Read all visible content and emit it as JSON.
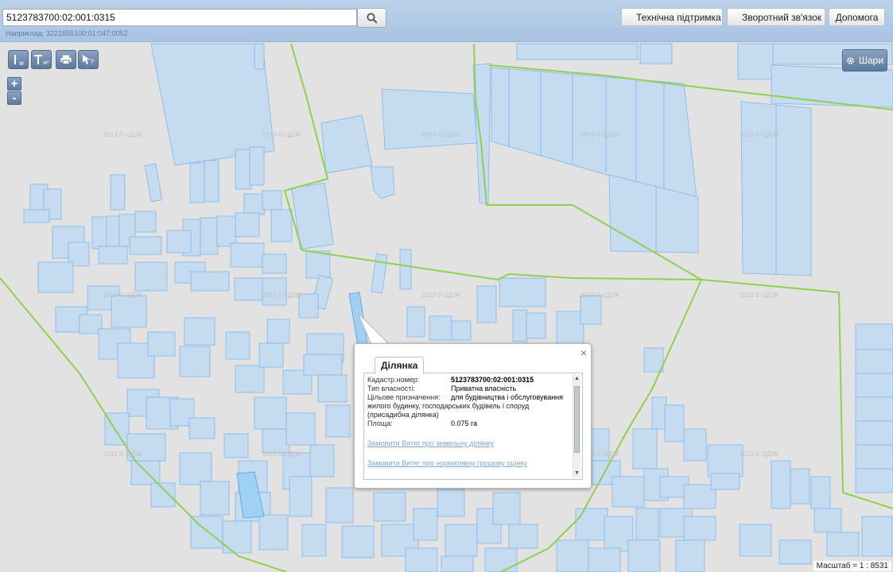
{
  "search": {
    "value": "5123783700:02:001:0315",
    "hint": "Наприклад: 3221655100:01:047:0052",
    "icon": "search-icon"
  },
  "header_buttons": {
    "support": "Технічна підтримка",
    "feedback": "Зворотний зв'язок",
    "help": "Допомога"
  },
  "map_tools": {
    "measure_length": "м",
    "measure_area": "м²",
    "print_icon": "print-icon",
    "info_icon": "info-query-icon"
  },
  "zoom": {
    "in": "+",
    "out": "-"
  },
  "layers_button": {
    "label": "Шари",
    "icon": "gear-icon"
  },
  "watermark": "2013 © ЦДЗК",
  "popup": {
    "tab": "Ділянка",
    "close": "×",
    "fields": {
      "cadastral_label": "Кадастр.номер:",
      "cadastral_value": "5123783700:02:001:0315",
      "ownership_label": "Тип власності:",
      "ownership_value": "Приватна власність",
      "purpose_label": "Цільове призначення:",
      "purpose_value_line1": "для будівництва і обслуговування",
      "purpose_value_rest": "жилого будинку, господарських будівель і споруд (присадибна ділянка)",
      "area_label": "Площа:",
      "area_value": "0.075 га"
    },
    "links": {
      "extract_land": "Замовити Витяг про земельну ділянку",
      "extract_valuation": "Замовити Витяг про нормативну грошову оцінку"
    }
  },
  "scale_text": "Масштаб = 1 : 8531",
  "colors": {
    "parcel_fill": "#c5dbf0",
    "parcel_stroke": "#7fb6e8",
    "boundary": "#8fd14f",
    "map_background": "#e2e2e2",
    "selected_parcel": "#9fd0f5"
  }
}
